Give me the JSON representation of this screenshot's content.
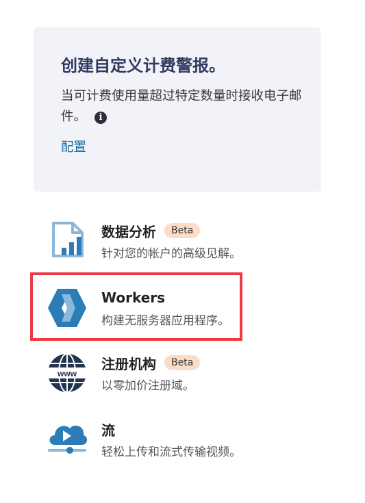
{
  "alert_card": {
    "title": "创建自定义计费警报。",
    "description": "当可计费使用量超过特定数量时接收电子邮件。",
    "info_icon_glyph": "i",
    "link_label": "配置"
  },
  "products": [
    {
      "name": "数据分析",
      "badge": "Beta",
      "description": "针对您的帐户的高级见解。",
      "icon": "analytics-icon"
    },
    {
      "name": "Workers",
      "badge": "",
      "description": "构建无服务器应用程序。",
      "icon": "workers-icon"
    },
    {
      "name": "注册机构",
      "badge": "Beta",
      "description": "以零加价注册域。",
      "icon": "www-globe-icon"
    },
    {
      "name": "流",
      "badge": "",
      "description": "轻松上传和流式传输视频。",
      "icon": "stream-cloud-icon"
    }
  ],
  "globe_label": "www",
  "colors": {
    "card_bg": "#f2f3f8",
    "title": "#323a60",
    "link": "#1a6aa0",
    "badge_bg": "#fbdcc7",
    "highlight": "#ec3b45",
    "icon_blue": "#2c7cb8",
    "icon_light_blue": "#8ab8dc",
    "icon_navy": "#23344f"
  }
}
